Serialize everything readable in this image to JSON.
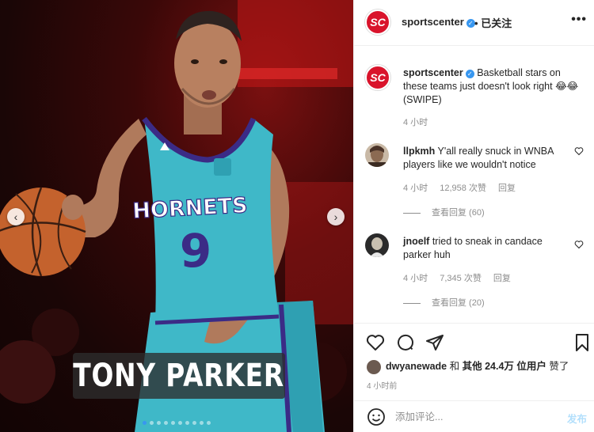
{
  "media": {
    "caption_overlay": "TONY PARKER",
    "jersey_team": "HORNETS",
    "jersey_number": "9",
    "prev_icon": "chevron-left-icon",
    "next_icon": "chevron-right-icon",
    "carousel_dot_count": 10,
    "carousel_active_index": 0
  },
  "header": {
    "username": "sportscenter",
    "verified_icon": "verified-badge-icon",
    "separator": "•",
    "follow_status": "已关注",
    "more_icon": "more-horizontal-icon",
    "more_label": "•••"
  },
  "caption": {
    "username": "sportscenter",
    "text": "Basketball stars on these teams just doesn't look right 😂😂 (SWIPE)",
    "time": "4 小时"
  },
  "comments": [
    {
      "username": "llpkmh",
      "text": "Y'all really snuck in WNBA players like we wouldn't notice",
      "time": "4 小时",
      "likes": "12,958 次赞",
      "reply_label": "回复",
      "view_replies": "查看回复 (60)"
    },
    {
      "username": "jnoelf",
      "text": "tried to sneak in candace parker huh",
      "time": "4 小时",
      "likes": "7,345 次赞",
      "reply_label": "回复",
      "view_replies": "查看回复 (20)"
    }
  ],
  "likes": {
    "liker": "dwyanewade",
    "and": "和",
    "others": "其他 24.4万 位用户",
    "liked": "赞了"
  },
  "post_time": "4 小时前",
  "comment_box": {
    "placeholder": "添加评论...",
    "post_label": "发布"
  },
  "colors": {
    "brand_red": "#d9132b",
    "link_blue": "#3897f0",
    "post_disabled": "#b2dffc",
    "jersey_teal": "#3fb8c8",
    "jersey_purple": "#3b2b86"
  }
}
